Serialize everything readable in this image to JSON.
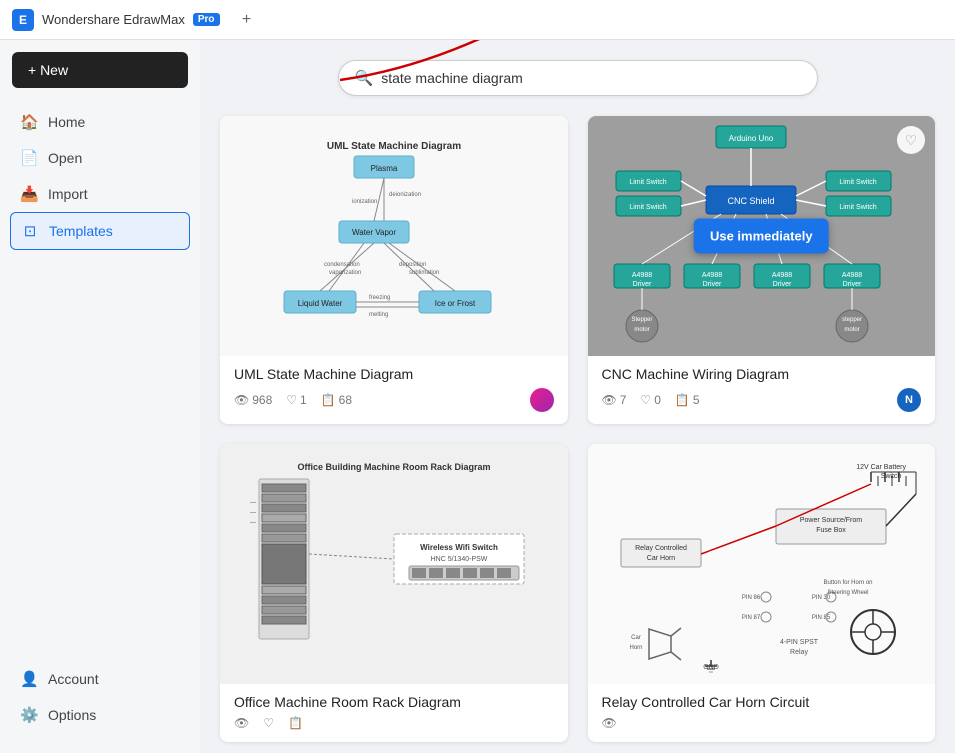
{
  "titleBar": {
    "appName": "Wondershare EdrawMax",
    "badge": "Pro",
    "tabPlus": "+"
  },
  "sidebar": {
    "newButton": "+ New",
    "items": [
      {
        "id": "home",
        "label": "Home",
        "icon": "🏠"
      },
      {
        "id": "open",
        "label": "Open",
        "icon": "📄"
      },
      {
        "id": "import",
        "label": "Import",
        "icon": "📥"
      },
      {
        "id": "templates",
        "label": "Templates",
        "icon": "⊡",
        "active": true
      }
    ],
    "bottomItems": [
      {
        "id": "account",
        "label": "Account",
        "icon": "👤"
      },
      {
        "id": "options",
        "label": "Options",
        "icon": "⚙️"
      }
    ]
  },
  "search": {
    "placeholder": "state machine diagram",
    "value": "state machine diagram"
  },
  "templates": [
    {
      "id": "uml-state-machine",
      "title": "UML State Machine Diagram",
      "views": "968",
      "likes": "1",
      "copies": "68",
      "avatarColor": "#e91e8c",
      "avatarLetter": ""
    },
    {
      "id": "cnc-machine-wiring",
      "title": "CNC Machine Wiring Diagram",
      "views": "7",
      "likes": "0",
      "copies": "5",
      "avatarColor": "#4a90d9",
      "avatarLetter": "N",
      "showUseImmediately": true,
      "useImmediatelyLabel": "Use immediately"
    },
    {
      "id": "office-machine-room",
      "title": "Office Machine Room Rack Diagram",
      "views": "",
      "likes": "",
      "copies": "",
      "avatarColor": "#888",
      "avatarLetter": ""
    },
    {
      "id": "relay-car-horn",
      "title": "Relay Controlled Car Horn Circuit",
      "views": "",
      "likes": "",
      "copies": "",
      "avatarColor": "#888",
      "avatarLetter": ""
    }
  ],
  "icons": {
    "search": "🔍",
    "heart": "♡",
    "eye": "👁",
    "copy": "📋",
    "plus": "✚"
  }
}
